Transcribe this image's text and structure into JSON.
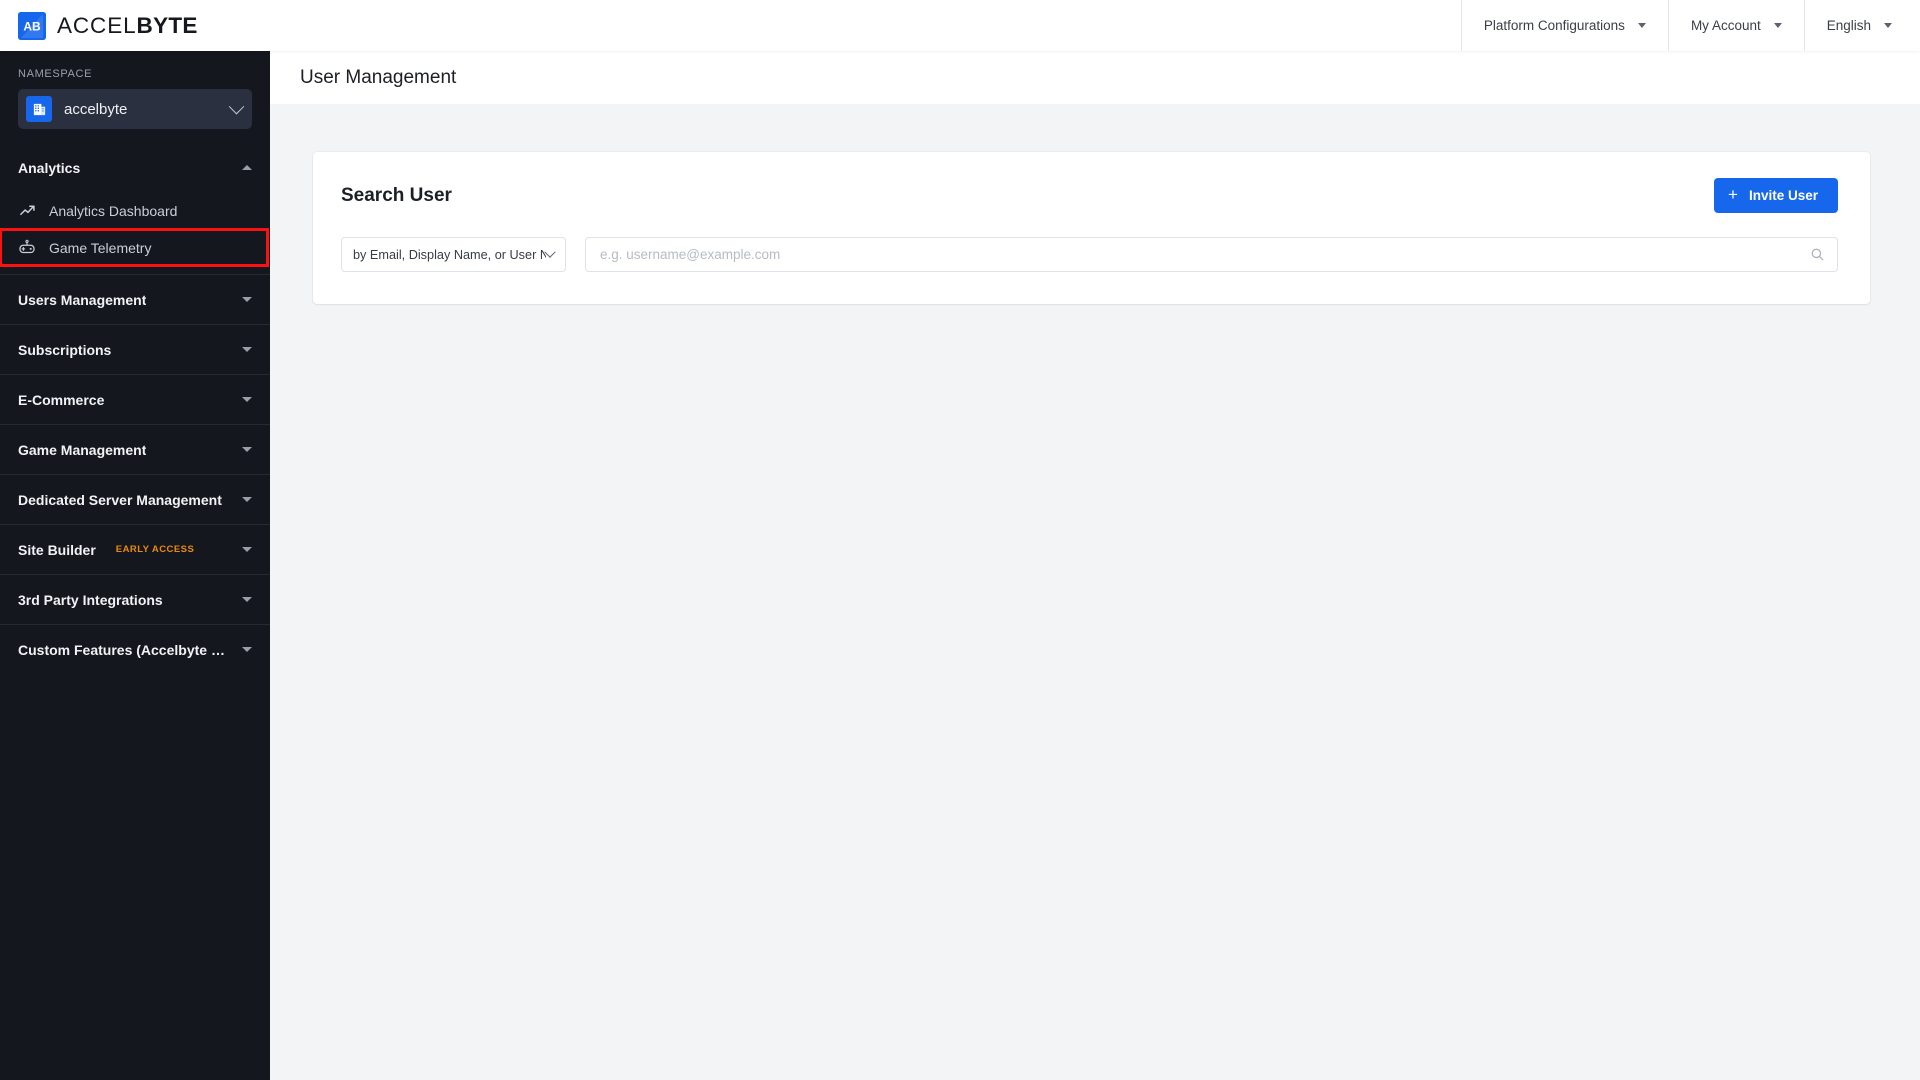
{
  "brand": {
    "name_light": "ACCEL",
    "name_bold": "BYTE",
    "logo_icon": "accelbyte-logo-icon",
    "logo_text": "AB",
    "accent": "#1767ec"
  },
  "topnav": {
    "items": [
      {
        "label": "Platform Configurations",
        "icon": "chevron-down-icon"
      },
      {
        "label": "My Account",
        "icon": "chevron-down-icon"
      },
      {
        "label": "English",
        "icon": "chevron-down-icon"
      }
    ]
  },
  "sidebar": {
    "namespace_label": "NAMESPACE",
    "namespace_value": "accelbyte",
    "namespace_icon": "building-icon",
    "namespace_chevron": "chevron-down-icon",
    "sections": [
      {
        "label": "Analytics",
        "expanded": true,
        "toggle_icon": "caret-up-icon",
        "badge": "",
        "items": [
          {
            "label": "Analytics Dashboard",
            "icon": "trend-up-icon",
            "highlighted": false
          },
          {
            "label": "Game Telemetry",
            "icon": "game-controller-icon",
            "highlighted": true
          }
        ]
      },
      {
        "label": "Users Management",
        "expanded": false,
        "toggle_icon": "caret-down-icon",
        "badge": "",
        "items": []
      },
      {
        "label": "Subscriptions",
        "expanded": false,
        "toggle_icon": "caret-down-icon",
        "badge": "",
        "items": []
      },
      {
        "label": "E-Commerce",
        "expanded": false,
        "toggle_icon": "caret-down-icon",
        "badge": "",
        "items": []
      },
      {
        "label": "Game Management",
        "expanded": false,
        "toggle_icon": "caret-down-icon",
        "badge": "",
        "items": []
      },
      {
        "label": "Dedicated Server Management",
        "expanded": false,
        "toggle_icon": "caret-down-icon",
        "badge": "",
        "items": []
      },
      {
        "label": "Site Builder",
        "expanded": false,
        "toggle_icon": "caret-down-icon",
        "badge": "EARLY ACCESS",
        "items": []
      },
      {
        "label": "3rd Party Integrations",
        "expanded": false,
        "toggle_icon": "caret-down-icon",
        "badge": "",
        "items": []
      },
      {
        "label": "Custom Features (Accelbyte In…",
        "expanded": false,
        "toggle_icon": "caret-down-icon",
        "badge": "",
        "items": []
      }
    ],
    "highlight_color": "#fb1111",
    "badge_color": "#e98a10"
  },
  "page": {
    "title": "User Management"
  },
  "search_panel": {
    "title": "Search User",
    "invite_button": {
      "label": "Invite User",
      "icon": "plus-icon"
    },
    "filter_select": {
      "value": "by Email, Display Name, or User Name",
      "icon": "chevron-down-icon"
    },
    "search_input": {
      "value": "",
      "placeholder": "e.g. username@example.com",
      "icon": "search-icon"
    }
  }
}
